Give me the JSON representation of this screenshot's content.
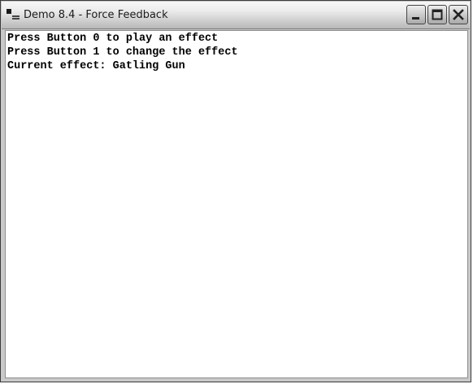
{
  "window": {
    "title": "Demo 8.4 - Force Feedback",
    "icon": "console-app-icon",
    "caption_buttons": [
      "minimize-icon",
      "maximize-icon",
      "close-icon"
    ]
  },
  "content": {
    "lines": [
      "Press Button 0 to play an effect",
      "Press Button 1 to change the effect",
      "Current effect: Gatling Gun"
    ]
  },
  "colors": {
    "background": "#ffffff",
    "text": "#000000"
  }
}
